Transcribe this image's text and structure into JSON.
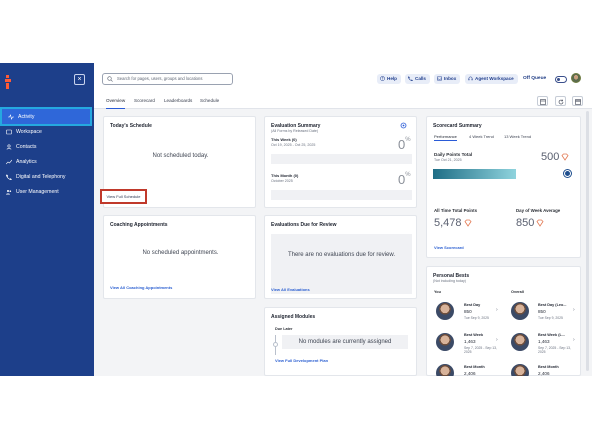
{
  "colors": {
    "sidebar": "#1d3f8a",
    "accent": "#2a5bd7",
    "highlight": "#c0392b"
  },
  "sidebar": {
    "collapse_icon": "close-icon",
    "items": [
      {
        "label": "Activity",
        "icon": "activity-icon",
        "active": true
      },
      {
        "label": "Workspace",
        "icon": "workspace-icon"
      },
      {
        "label": "Contacts",
        "icon": "contacts-icon"
      },
      {
        "label": "Analytics",
        "icon": "analytics-icon"
      },
      {
        "label": "Digital and Telephony",
        "icon": "telephony-icon"
      },
      {
        "label": "User Management",
        "icon": "users-icon"
      }
    ]
  },
  "topbar": {
    "search_placeholder": "Search for pages, users, groups and locations",
    "help": "Help",
    "calls": "Calls",
    "inbox": "Inbox",
    "agent_workspace": "Agent Workspace",
    "off_queue": "Off Queue"
  },
  "tabs": [
    "Overview",
    "Scorecard",
    "Leaderboards",
    "Schedule"
  ],
  "schedule": {
    "title": "Today's Schedule",
    "empty": "Not scheduled today.",
    "link": "View Full Schedule"
  },
  "evaluation": {
    "title": "Evaluation Summary",
    "subtitle": "(All Forms by Released Date)",
    "week_label": "This Week (0)",
    "week_range": "Oct 19, 2025 - Oct 25, 2025",
    "week_value": "0",
    "pct": "%",
    "month_label": "This Month (0)",
    "month_name": "October 2025",
    "month_value": "0"
  },
  "scorecard": {
    "title": "Scorecard Summary",
    "tabs": [
      "Performance",
      "4 Week Trend",
      "13 Week Trend"
    ],
    "daily_label": "Daily Points Total",
    "daily_date": "Tue Oct 21, 2025",
    "daily_value": "500",
    "progress": 0.6,
    "alltime_label": "All Time Total Points",
    "alltime_value": "5,478",
    "dayavg_label": "Day of Week Average",
    "dayavg_value": "850",
    "link": "View Scorecard"
  },
  "coaching": {
    "title": "Coaching Appointments",
    "empty": "No scheduled appointments.",
    "link": "View All Coaching Appointments"
  },
  "review": {
    "title": "Evaluations Due for Review",
    "empty": "There are no evaluations due for review.",
    "link": "View All Evaluations"
  },
  "modules": {
    "title": "Assigned Modules",
    "due_label": "Due Later",
    "empty": "No modules are currently assigned",
    "link": "View Full Development Plan"
  },
  "bests": {
    "title": "Personal Bests",
    "subtitle": "(Not including today)",
    "you": "You",
    "overall": "Overall",
    "rows": [
      {
        "label": "Best Day",
        "value": "850",
        "date": "Tue Sep 9, 2025",
        "o_label": "Best Day (Leo...",
        "o_value": "850",
        "o_date": "Tue Sep 9, 2025"
      },
      {
        "label": "Best Week",
        "value": "1,463",
        "date": "Sep 7, 2025 - Sep 13, 2025",
        "o_label": "Best Week (L...",
        "o_value": "1,463",
        "o_date": "Sep 7, 2025 - Sep 13, 2025"
      },
      {
        "label": "Best Month",
        "value": "2,406",
        "date": "",
        "o_label": "Best Month",
        "o_value": "2,406",
        "o_date": ""
      }
    ]
  }
}
